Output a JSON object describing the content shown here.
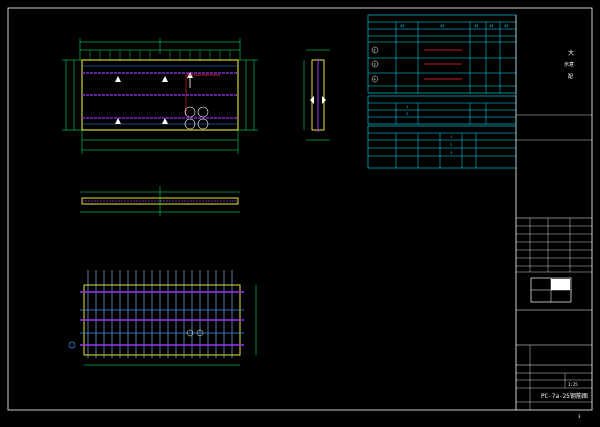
{
  "colors": {
    "background": "#000000",
    "frame": "#ffffff",
    "table_line": "#00e6ff",
    "dimension": "#00ff66",
    "outline": "#ffff33",
    "rebar_main": "#9933ff",
    "rebar_dist": "#3399ff",
    "highlight": "#ff2a2a"
  },
  "side_note": {
    "line1": "大",
    "line2": "示意",
    "line3": "配"
  },
  "drawing_title": "PC-7a-25钢筋图",
  "sheet_number": "3",
  "scale_value": "1:25",
  "table1_header_values": [
    "43",
    "43",
    "43",
    "43",
    "43"
  ],
  "table1_row_values": [
    "2",
    "3",
    "4"
  ],
  "table2_values": [
    "1",
    "2"
  ],
  "table3_values": [
    "1",
    "2",
    "3"
  ]
}
